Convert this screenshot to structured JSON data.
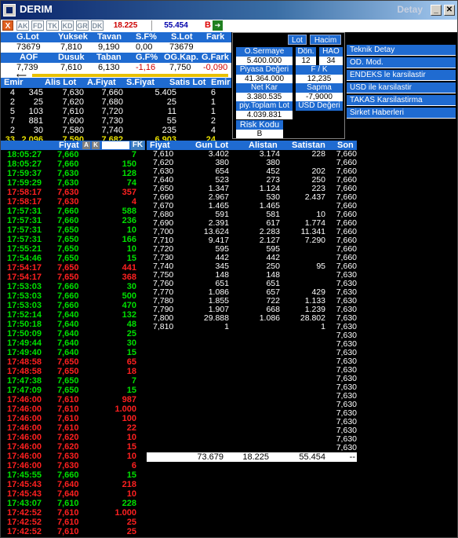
{
  "window": {
    "title": "DERIM",
    "right_label": "Detay"
  },
  "toolbar": {
    "tabs": [
      "AK",
      "FD",
      "TK",
      "KD",
      "GR",
      "DK"
    ],
    "close": "X",
    "volume": "18.225",
    "volume2": "55.454",
    "b_label": "B",
    "arrow": "➔"
  },
  "header1": {
    "labels": [
      "G.Lot",
      "Yuksek",
      "Tavan",
      "S.F%",
      "S.Lot",
      "Fark"
    ],
    "values": [
      "73679",
      "7,810",
      "9,190",
      "0,00",
      "73679",
      ""
    ]
  },
  "header2": {
    "labels": [
      "AOF",
      "Dusuk",
      "Taban",
      "G.F%",
      "OG.Kap.",
      "G.Fark"
    ],
    "values": [
      "7,739",
      "7,610",
      "6,130",
      "-1,16",
      "7,750",
      "-0,090"
    ],
    "colors": [
      "#000000",
      "#000000",
      "#000000",
      "#d00000",
      "#000000",
      "#d00000"
    ]
  },
  "depth": {
    "headers": [
      "Emir",
      "Alis Lot",
      "A.Fiyat",
      "S.Fiyat",
      "Satis Lot",
      "Emir"
    ],
    "rows": [
      [
        "4",
        "345",
        "7,630",
        "7,660",
        "5.405",
        "6"
      ],
      [
        "2",
        "25",
        "7,620",
        "7,680",
        "25",
        "1"
      ],
      [
        "5",
        "103",
        "7,610",
        "7,720",
        "11",
        "1"
      ],
      [
        "7",
        "881",
        "7,600",
        "7,730",
        "55",
        "2"
      ],
      [
        "2",
        "30",
        "7,580",
        "7,740",
        "235",
        "4"
      ]
    ],
    "totals": [
      "33",
      "2.096",
      "7,590",
      "7,682",
      "6.903",
      "24"
    ]
  },
  "right_panel": {
    "buttons": [
      "Lot",
      "Hacim"
    ],
    "o_sermaye_label": "O.Sermaye",
    "o_sermaye": "5.400.000",
    "don_label": "Dön.",
    "don": "12",
    "hao_label": "HAO",
    "hao": "34",
    "piyasa_label": "Piyasa Değeri",
    "piyasa": "41.364.000",
    "fk_label": "F / K",
    "fk": "12,235",
    "netkar_label": "Net Kar",
    "netkar": "3.380.535",
    "sapma_label": "Sapma",
    "sapma": "-7,9000",
    "piytop_label": "piy.Toplam Lot",
    "piytop": "4.039.831",
    "usd_label": "USD Değeri",
    "risk_label": "Risk Kodu",
    "risk": "B"
  },
  "menu": [
    "Teknik Detay",
    "OD. Mod.",
    "ENDEKS le karsilastir",
    "USD ile karsilastir",
    "TAKAS Karsilastirma",
    "Sirket Haberleri"
  ],
  "trades_header": {
    "fiyat": "Fiyat",
    "a": "A",
    "k": "K",
    "fk": "FK"
  },
  "trades": [
    [
      "18:05:27",
      "7,660",
      "7",
      "g"
    ],
    [
      "18:05:27",
      "7,660",
      "150",
      "g"
    ],
    [
      "17:59:37",
      "7,630",
      "128",
      "g"
    ],
    [
      "17:59:29",
      "7,630",
      "74",
      "g"
    ],
    [
      "17:58:17",
      "7,630",
      "357",
      "r"
    ],
    [
      "17:58:17",
      "7,630",
      "4",
      "r"
    ],
    [
      "17:57:31",
      "7,660",
      "588",
      "g"
    ],
    [
      "17:57:31",
      "7,660",
      "236",
      "g"
    ],
    [
      "17:57:31",
      "7,650",
      "10",
      "g"
    ],
    [
      "17:57:31",
      "7,650",
      "166",
      "g"
    ],
    [
      "17:55:21",
      "7,650",
      "10",
      "g"
    ],
    [
      "17:54:46",
      "7,650",
      "15",
      "g"
    ],
    [
      "17:54:17",
      "7,650",
      "441",
      "r"
    ],
    [
      "17:54:17",
      "7,650",
      "368",
      "r"
    ],
    [
      "17:53:03",
      "7,660",
      "30",
      "g"
    ],
    [
      "17:53:03",
      "7,660",
      "500",
      "g"
    ],
    [
      "17:53:03",
      "7,660",
      "470",
      "g"
    ],
    [
      "17:52:14",
      "7,640",
      "132",
      "g"
    ],
    [
      "17:50:18",
      "7,640",
      "48",
      "g"
    ],
    [
      "17:50:09",
      "7,640",
      "25",
      "g"
    ],
    [
      "17:49:44",
      "7,640",
      "30",
      "g"
    ],
    [
      "17:49:40",
      "7,640",
      "15",
      "g"
    ],
    [
      "17:48:58",
      "7,650",
      "65",
      "r"
    ],
    [
      "17:48:58",
      "7,650",
      "18",
      "r"
    ],
    [
      "17:47:38",
      "7,650",
      "7",
      "g"
    ],
    [
      "17:47:09",
      "7,650",
      "15",
      "g"
    ],
    [
      "17:46:00",
      "7,610",
      "987",
      "r"
    ],
    [
      "17:46:00",
      "7,610",
      "1.000",
      "r"
    ],
    [
      "17:46:00",
      "7,610",
      "100",
      "r"
    ],
    [
      "17:46:00",
      "7,610",
      "22",
      "r"
    ],
    [
      "17:46:00",
      "7,620",
      "10",
      "r"
    ],
    [
      "17:46:00",
      "7,620",
      "15",
      "r"
    ],
    [
      "17:46:00",
      "7,630",
      "10",
      "r"
    ],
    [
      "17:46:00",
      "7,630",
      "6",
      "r"
    ],
    [
      "17:45:55",
      "7,660",
      "15",
      "g"
    ],
    [
      "17:45:43",
      "7,640",
      "218",
      "r"
    ],
    [
      "17:45:43",
      "7,640",
      "10",
      "r"
    ],
    [
      "17:43:07",
      "7,610",
      "228",
      "g"
    ],
    [
      "17:42:52",
      "7,610",
      "1.000",
      "r"
    ],
    [
      "17:42:52",
      "7,610",
      "25",
      "r"
    ],
    [
      "17:42:52",
      "7,610",
      "25",
      "r"
    ]
  ],
  "price_table": {
    "headers": [
      "Fiyat",
      "Gun Lot",
      "Alistan",
      "Satistan",
      "Son"
    ],
    "rows": [
      [
        "7,610",
        "3.402",
        "3.174",
        "228",
        "7,660"
      ],
      [
        "7,620",
        "380",
        "380",
        "",
        "7,660"
      ],
      [
        "7,630",
        "654",
        "452",
        "202",
        "7,660"
      ],
      [
        "7,640",
        "523",
        "273",
        "250",
        "7,660"
      ],
      [
        "7,650",
        "1.347",
        "1.124",
        "223",
        "7,660"
      ],
      [
        "7,660",
        "2.967",
        "530",
        "2.437",
        "7,660"
      ],
      [
        "7,670",
        "1.465",
        "1.465",
        "",
        "7,660"
      ],
      [
        "7,680",
        "591",
        "581",
        "10",
        "7,660"
      ],
      [
        "7,690",
        "2.391",
        "617",
        "1.774",
        "7,660"
      ],
      [
        "7,700",
        "13.624",
        "2.283",
        "11.341",
        "7,660"
      ],
      [
        "7,710",
        "9.417",
        "2.127",
        "7.290",
        "7,660"
      ],
      [
        "7,720",
        "595",
        "595",
        "",
        "7,660"
      ],
      [
        "7,730",
        "442",
        "442",
        "",
        "7,660"
      ],
      [
        "7,740",
        "345",
        "250",
        "95",
        "7,660"
      ],
      [
        "7,750",
        "148",
        "148",
        "",
        "7,630"
      ],
      [
        "7,760",
        "651",
        "651",
        "",
        "7,630"
      ],
      [
        "7,770",
        "1.086",
        "657",
        "429",
        "7,630"
      ],
      [
        "7,780",
        "1.855",
        "722",
        "1.133",
        "7,630"
      ],
      [
        "7,790",
        "1.907",
        "668",
        "1.239",
        "7,630"
      ],
      [
        "7,800",
        "29.888",
        "1.086",
        "28.802",
        "7,630"
      ],
      [
        "7,810",
        "1",
        "",
        "1",
        "7,630"
      ],
      [
        "",
        "",
        "",
        "",
        "7,630"
      ],
      [
        "",
        "",
        "",
        "",
        "7,630"
      ],
      [
        "",
        "",
        "",
        "",
        "7,630"
      ],
      [
        "",
        "",
        "",
        "",
        "7,630"
      ],
      [
        "",
        "",
        "",
        "",
        "7,630"
      ],
      [
        "",
        "",
        "",
        "",
        "7,630"
      ],
      [
        "",
        "",
        "",
        "",
        "7,630"
      ],
      [
        "",
        "",
        "",
        "",
        "7,630"
      ],
      [
        "",
        "",
        "",
        "",
        "7,630"
      ],
      [
        "",
        "",
        "",
        "",
        "7,630"
      ],
      [
        "",
        "",
        "",
        "",
        "7,630"
      ],
      [
        "",
        "",
        "",
        "",
        "7,630"
      ],
      [
        "",
        "",
        "",
        "",
        "7,630"
      ],
      [
        "",
        "",
        "",
        "",
        "7,630"
      ]
    ],
    "totals": [
      "73.679",
      "18.225",
      "55.454",
      "--"
    ]
  }
}
